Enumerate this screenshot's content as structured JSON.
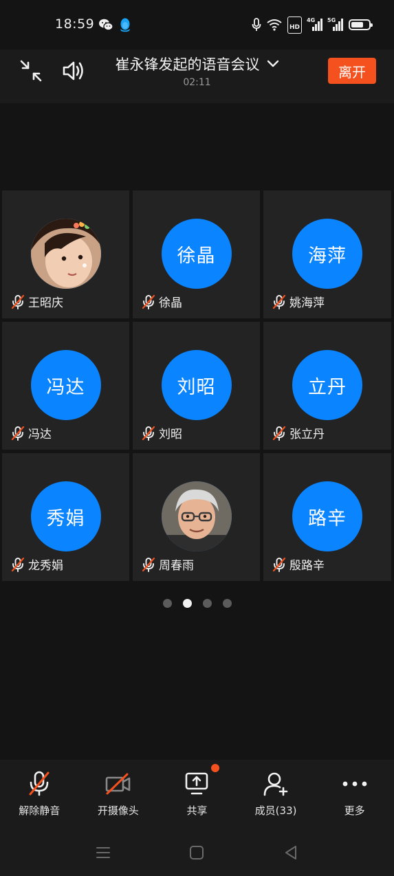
{
  "status_bar": {
    "time": "18:59",
    "icons": [
      "wechat-icon",
      "qq-icon",
      "microphone-icon",
      "wifi-icon",
      "hd-icon",
      "signal-4g-icon",
      "signal-5g-icon",
      "battery-icon"
    ],
    "hd_label": "HD",
    "net1": "4G",
    "net2": "5G",
    "battery_level": 0.7
  },
  "header": {
    "title": "崔永锋发起的语音会议",
    "duration": "02:11",
    "leave_label": "离开"
  },
  "colors": {
    "accent_orange": "#f4511e",
    "avatar_blue": "#0a84ff",
    "tile_bg": "#232323",
    "background": "#141414"
  },
  "participants": [
    {
      "name": "王昭庆",
      "avatar_text": "",
      "avatar_type": "photo-child"
    },
    {
      "name": "徐晶",
      "avatar_text": "徐晶",
      "avatar_type": "initials"
    },
    {
      "name": "姚海萍",
      "avatar_text": "海萍",
      "avatar_type": "initials"
    },
    {
      "name": "冯达",
      "avatar_text": "冯达",
      "avatar_type": "initials"
    },
    {
      "name": "刘昭",
      "avatar_text": "刘昭",
      "avatar_type": "initials"
    },
    {
      "name": "张立丹",
      "avatar_text": "立丹",
      "avatar_type": "initials"
    },
    {
      "name": "龙秀娟",
      "avatar_text": "秀娟",
      "avatar_type": "initials"
    },
    {
      "name": "周春雨",
      "avatar_text": "",
      "avatar_type": "photo-cartoon"
    },
    {
      "name": "殷路辛",
      "avatar_text": "路辛",
      "avatar_type": "initials"
    }
  ],
  "pager": {
    "pages": 4,
    "active": 2
  },
  "toolbar": {
    "unmute": "解除静音",
    "camera": "开摄像头",
    "share": "共享",
    "members": "成员(33)",
    "more": "更多"
  }
}
